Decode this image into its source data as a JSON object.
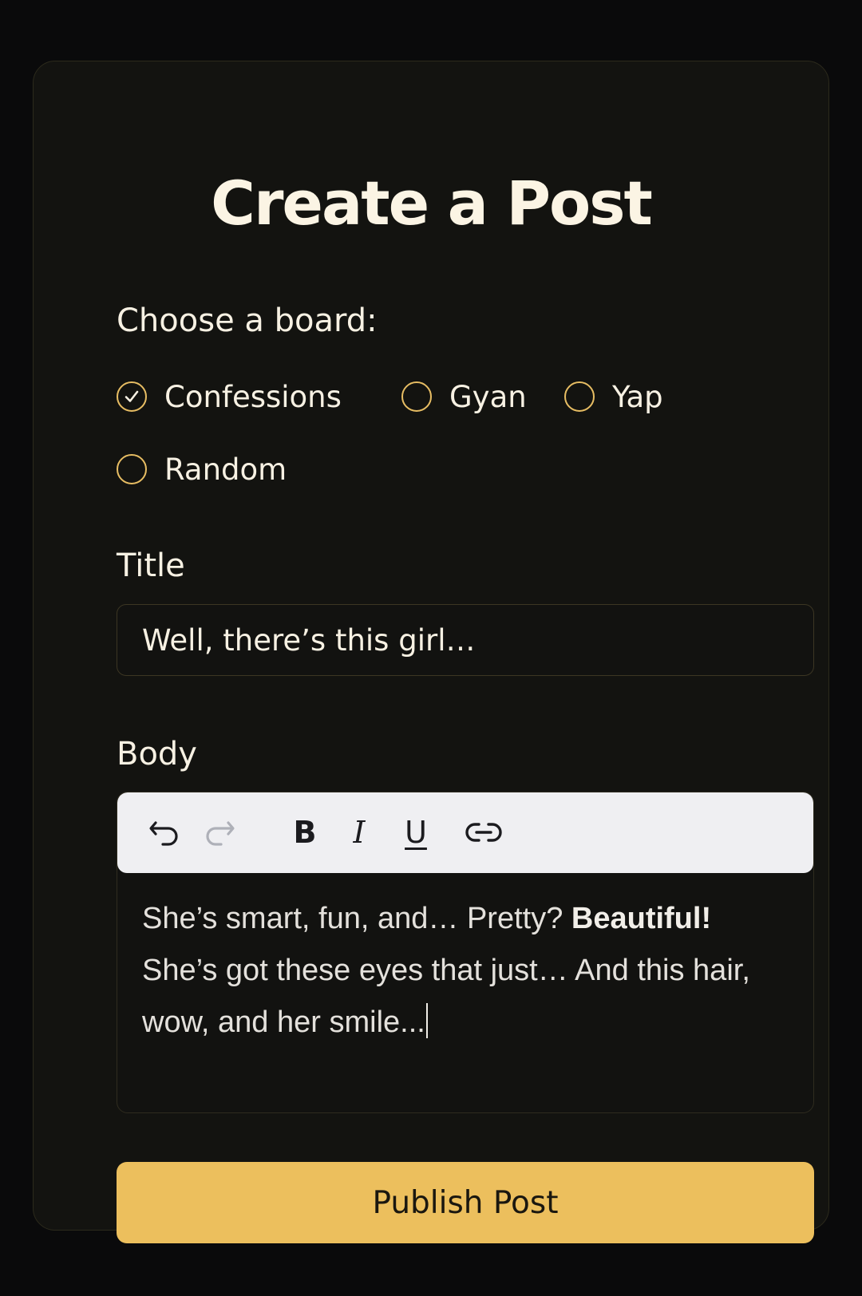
{
  "form": {
    "heading": "Create a Post",
    "board_label": "Choose a board:",
    "boards": [
      {
        "label": "Confessions",
        "selected": true
      },
      {
        "label": "Gyan",
        "selected": false
      },
      {
        "label": "Yap",
        "selected": false
      },
      {
        "label": "Random",
        "selected": false
      }
    ],
    "title_label": "Title",
    "title_value": "Well, there’s this girl…",
    "body_label": "Body",
    "body": {
      "segment_1": "She’s smart, fun, and… Pretty? ",
      "bold_segment": "Beautiful!",
      "segment_2": " She’s got these eyes that just… And this hair, wow, and her smile..."
    },
    "toolbar": {
      "icons": [
        "undo-icon",
        "redo-icon",
        "bold-icon",
        "italic-icon",
        "underline-icon",
        "link-icon"
      ],
      "bold_glyph": "B",
      "italic_glyph": "I",
      "underline_glyph": "U"
    },
    "publish_label": "Publish Post"
  },
  "colors": {
    "background": "#0a0a0b",
    "card": "#131310",
    "accent": "#ecbf5d",
    "text": "#f7f1e3",
    "toolbar": "#efeff2"
  }
}
